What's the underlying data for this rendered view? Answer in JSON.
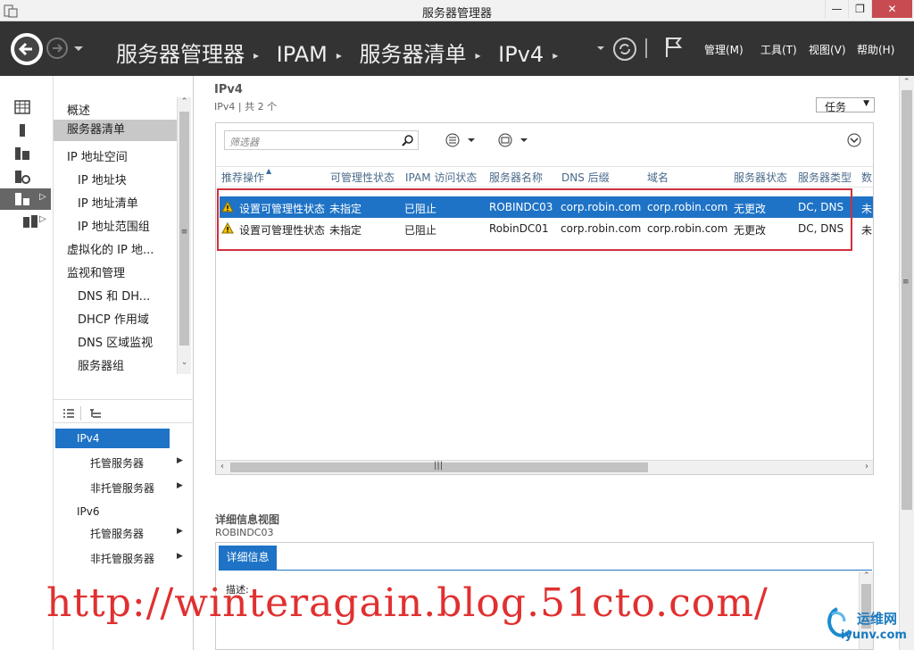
{
  "window": {
    "title": "服务器管理器",
    "minimize": "—",
    "maximize": "❐",
    "close": "✕"
  },
  "header": {
    "breadcrumbs": [
      "服务器管理器",
      "IPAM",
      "服务器清单",
      "IPv4"
    ],
    "menus": [
      "管理(M)",
      "工具(T)",
      "视图(V)",
      "帮助(H)"
    ]
  },
  "nav": {
    "items": [
      {
        "label": "概述",
        "level": 0
      },
      {
        "label": "服务器清单",
        "level": 0,
        "selected": true
      },
      {
        "label": "IP 地址空间",
        "level": 0
      },
      {
        "label": "IP 地址块",
        "level": 1
      },
      {
        "label": "IP 地址清单",
        "level": 1
      },
      {
        "label": "IP 地址范围组",
        "level": 1
      },
      {
        "label": "虚拟化的 IP 地...",
        "level": 0
      },
      {
        "label": "监视和管理",
        "level": 0
      },
      {
        "label": "DNS 和 DH...",
        "level": 1
      },
      {
        "label": "DHCP 作用域",
        "level": 1
      },
      {
        "label": "DNS 区域监视",
        "level": 1
      },
      {
        "label": "服务器组",
        "level": 1
      }
    ],
    "tasks": {
      "selected": "IPv4",
      "groups": [
        {
          "label": "IPv4",
          "children": [
            "托管服务器",
            "非托管服务器"
          ]
        },
        {
          "label": "IPv6",
          "children": [
            "托管服务器",
            "非托管服务器"
          ]
        }
      ]
    }
  },
  "main": {
    "title": "IPv4",
    "subtitle": "IPv4 | 共 2 个",
    "tasks_button": "任务",
    "filter_placeholder": "筛选器",
    "columns": [
      "推荐操作",
      "可管理性状态",
      "IPAM 访问状态",
      "服务器名称",
      "DNS 后缀",
      "域名",
      "服务器状态",
      "服务器类型",
      "数"
    ],
    "rows": [
      [
        "设置可管理性状态",
        "未指定",
        "已阻止",
        "ROBINDC03",
        "corp.robin.com",
        "corp.robin.com",
        "无更改",
        "DC, DNS",
        "未"
      ],
      [
        "设置可管理性状态",
        "未指定",
        "已阻止",
        "RobinDC01",
        "corp.robin.com",
        "corp.robin.com",
        "无更改",
        "DC, DNS",
        "未"
      ]
    ],
    "details": {
      "title": "详细信息视图",
      "server": "ROBINDC03",
      "tab": "详细信息",
      "desc_label": "描述:"
    }
  },
  "overlay": {
    "watermark": "http://winteragain.blog.51cto.com/",
    "logo_text": "运维网",
    "logo_url": "iyunv.com"
  },
  "colors": {
    "header_bg": "#333333",
    "selection": "#1e73c6",
    "highlight_box": "#d0303c",
    "watermark": "#e03030"
  }
}
